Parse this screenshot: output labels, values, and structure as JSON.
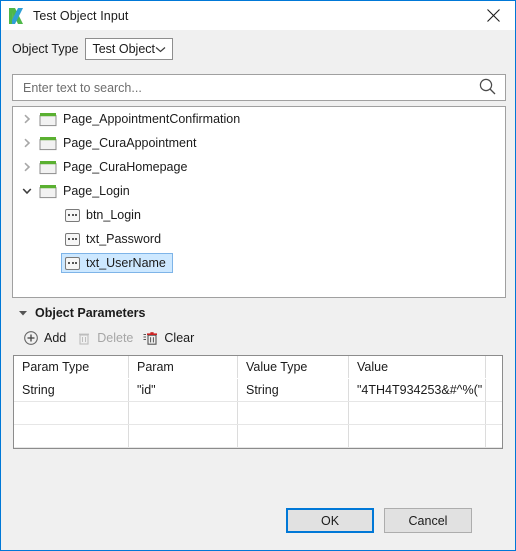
{
  "window": {
    "title": "Test Object Input",
    "app_icon": "katalon-logo-icon",
    "close_icon": "close-icon",
    "border_color": "#0078d7"
  },
  "object_type": {
    "label": "Object Type",
    "selected": "Test Object",
    "dropdown_icon": "chevron-down-icon"
  },
  "search": {
    "value": "",
    "placeholder": "Enter text to search...",
    "icon": "search-icon"
  },
  "tree": {
    "items": [
      {
        "label": "Page_AppointmentConfirmation",
        "level": 0,
        "type": "folder",
        "expanded": false,
        "selected": false,
        "twisty": "chevron-right-icon"
      },
      {
        "label": "Page_CuraAppointment",
        "level": 0,
        "type": "folder",
        "expanded": false,
        "selected": false,
        "twisty": "chevron-right-icon"
      },
      {
        "label": "Page_CuraHomepage",
        "level": 0,
        "type": "folder",
        "expanded": false,
        "selected": false,
        "twisty": "chevron-right-icon"
      },
      {
        "label": "Page_Login",
        "level": 0,
        "type": "folder",
        "expanded": true,
        "selected": false,
        "twisty": "chevron-down-icon"
      },
      {
        "label": "btn_Login",
        "level": 1,
        "type": "element",
        "expanded": false,
        "selected": false,
        "twisty": ""
      },
      {
        "label": "txt_Password",
        "level": 1,
        "type": "element",
        "expanded": false,
        "selected": false,
        "twisty": ""
      },
      {
        "label": "txt_UserName",
        "level": 1,
        "type": "element",
        "expanded": false,
        "selected": true,
        "twisty": ""
      }
    ],
    "selection_color": "#cde8ff"
  },
  "parameters_section": {
    "title": "Object Parameters",
    "collapsed": false,
    "collapse_icon": "triangle-down-icon",
    "toolbar": [
      {
        "label": "Add",
        "icon": "plus-circle-icon",
        "enabled": true
      },
      {
        "label": "Delete",
        "icon": "trash-icon",
        "enabled": false
      },
      {
        "label": "Clear",
        "icon": "clear-trash-icon",
        "enabled": true
      }
    ],
    "table": {
      "columns": [
        "Param Type",
        "Param",
        "Value Type",
        "Value",
        ""
      ],
      "rows": [
        [
          "String",
          "\"id\"",
          "String",
          "\"4TH4T934253&#^%(\"",
          ""
        ],
        [
          "",
          "",
          "",
          "",
          ""
        ],
        [
          "",
          "",
          "",
          "",
          ""
        ],
        [
          "",
          "",
          "",
          "",
          ""
        ]
      ]
    }
  },
  "footer": {
    "ok_label": "OK",
    "cancel_label": "Cancel",
    "focus_color": "#0078d7"
  }
}
